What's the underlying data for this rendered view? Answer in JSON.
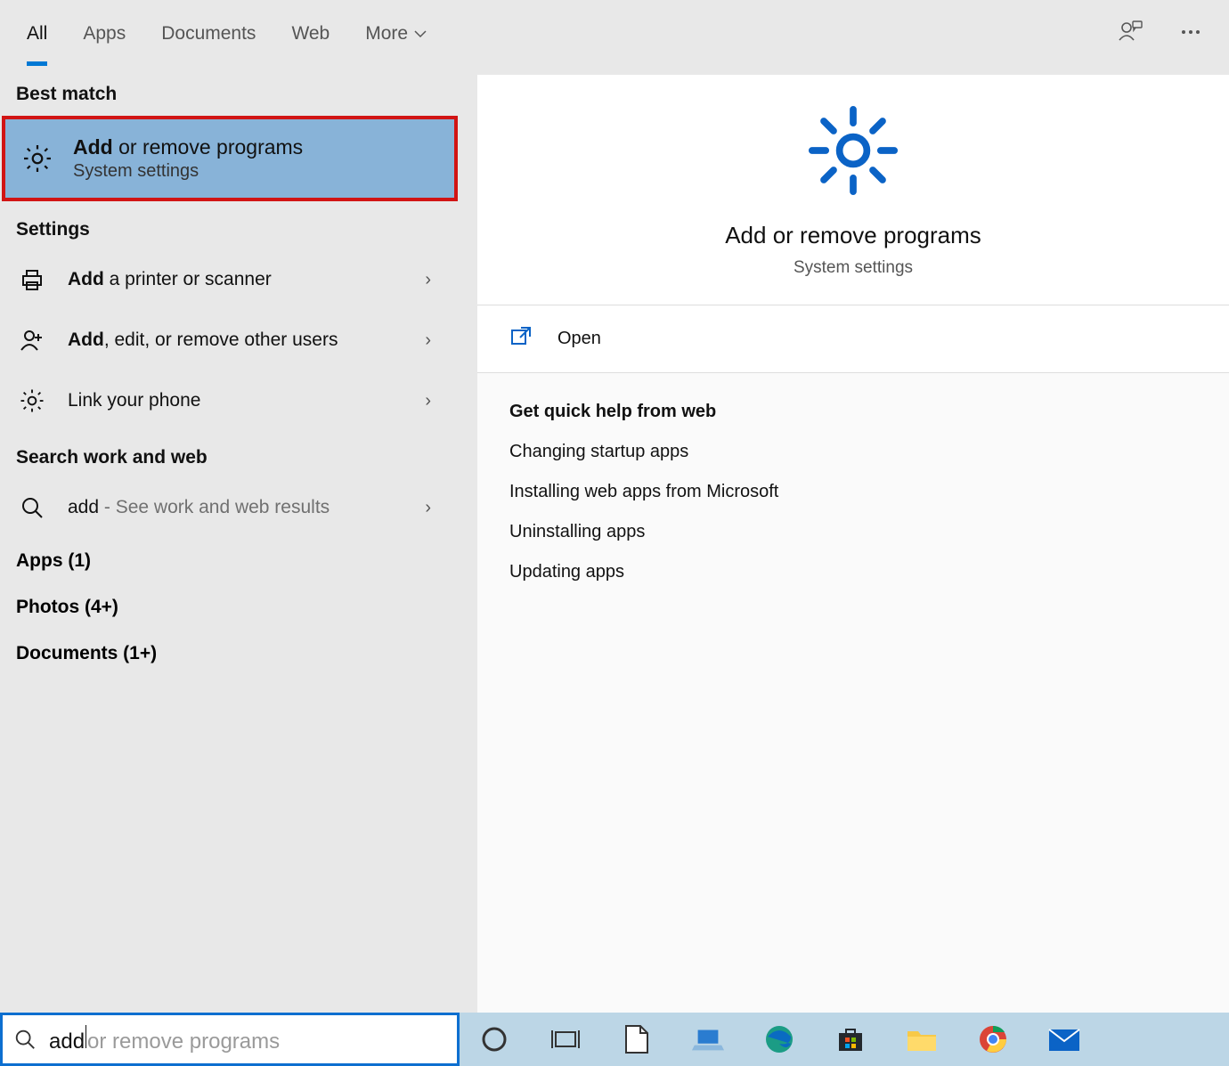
{
  "header": {
    "tabs": [
      "All",
      "Apps",
      "Documents",
      "Web",
      "More"
    ]
  },
  "left": {
    "best_match_header": "Best match",
    "best_match": {
      "title_bold": "Add",
      "title_rest": " or remove programs",
      "subtitle": "System settings"
    },
    "settings_header": "Settings",
    "settings": [
      {
        "bold": "Add",
        "rest": " a printer or scanner"
      },
      {
        "bold": "Add",
        "rest": ", edit, or remove other users"
      },
      {
        "bold": "",
        "rest": "Link your phone"
      }
    ],
    "web_header": "Search work and web",
    "web": {
      "term": "add",
      "suffix": " - See work and web results"
    },
    "categories": [
      "Apps (1)",
      "Photos (4+)",
      "Documents (1+)"
    ]
  },
  "right": {
    "title": "Add or remove programs",
    "subtitle": "System settings",
    "open_label": "Open",
    "help_heading": "Get quick help from web",
    "help_links": [
      "Changing startup apps",
      "Installing web apps from Microsoft",
      "Uninstalling apps",
      "Updating apps"
    ]
  },
  "search": {
    "typed": "add",
    "placeholder_rest": " or remove programs"
  }
}
